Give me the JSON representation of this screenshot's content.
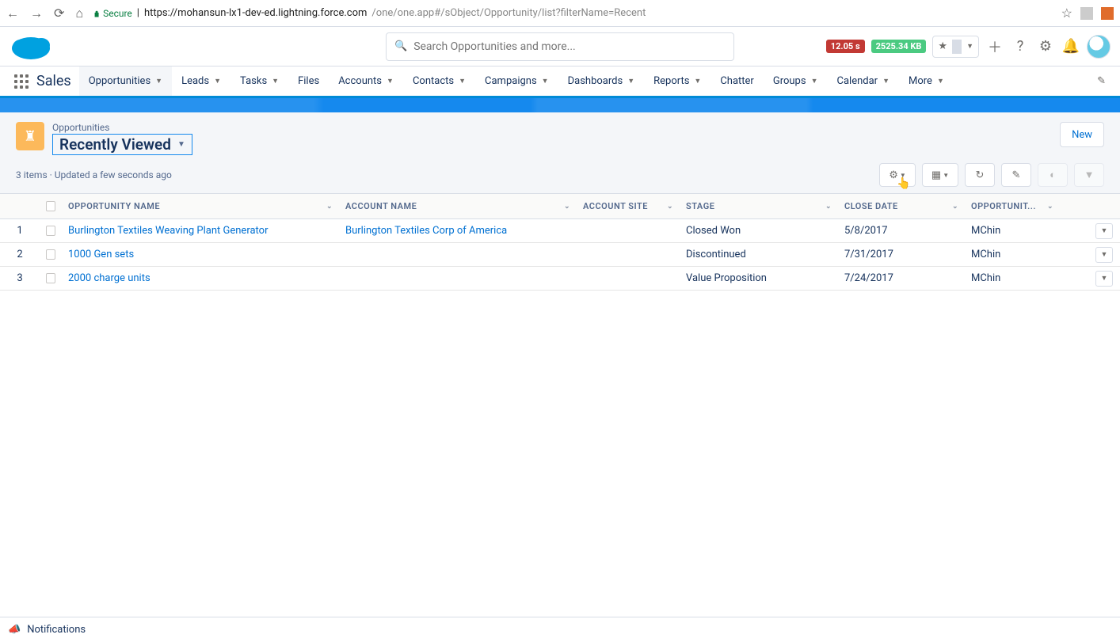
{
  "browser": {
    "secure_label": "Secure",
    "url_host": "https://mohansun-lx1-dev-ed.lightning.force.com",
    "url_path": "/one/one.app#/sObject/Opportunity/list?filterName=Recent"
  },
  "header": {
    "search_placeholder": "Search Opportunities and more...",
    "debug_time": "12.05 s",
    "debug_size": "2525.34 KB"
  },
  "nav": {
    "app_name": "Sales",
    "items": [
      "Opportunities",
      "Leads",
      "Tasks",
      "Files",
      "Accounts",
      "Contacts",
      "Campaigns",
      "Dashboards",
      "Reports",
      "Chatter",
      "Groups",
      "Calendar",
      "More"
    ],
    "active_index": 0,
    "no_caret_indices": [
      3,
      9
    ]
  },
  "page_header": {
    "object_label": "Opportunities",
    "view_name": "Recently Viewed",
    "new_button": "New",
    "meta": "3 items · Updated a few seconds ago"
  },
  "table": {
    "columns": [
      "OPPORTUNITY NAME",
      "ACCOUNT NAME",
      "ACCOUNT SITE",
      "STAGE",
      "CLOSE DATE",
      "OPPORTUNIT..."
    ],
    "rows": [
      {
        "num": "1",
        "opp": "Burlington Textiles Weaving Plant Generator",
        "acc": "Burlington Textiles Corp of America",
        "site": "",
        "stage": "Closed Won",
        "close": "5/8/2017",
        "owner": "MChin"
      },
      {
        "num": "2",
        "opp": "1000 Gen sets",
        "acc": "",
        "site": "",
        "stage": "Discontinued",
        "close": "7/31/2017",
        "owner": "MChin"
      },
      {
        "num": "3",
        "opp": "2000 charge units",
        "acc": "",
        "site": "",
        "stage": "Value Proposition",
        "close": "7/24/2017",
        "owner": "MChin"
      }
    ]
  },
  "footer": {
    "notifications": "Notifications"
  }
}
